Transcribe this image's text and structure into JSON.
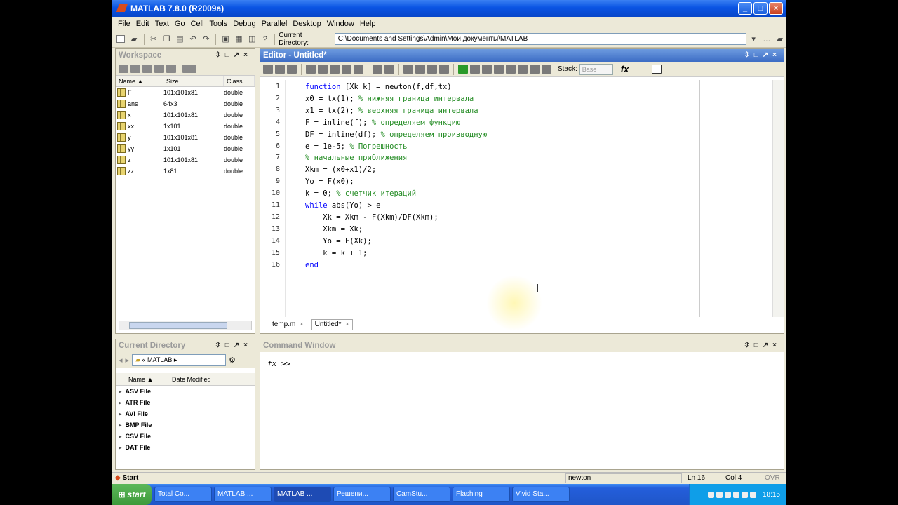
{
  "window": {
    "title": "MATLAB  7.8.0 (R2009a)"
  },
  "menu": [
    "File",
    "Edit",
    "Text",
    "Go",
    "Cell",
    "Tools",
    "Debug",
    "Parallel",
    "Desktop",
    "Window",
    "Help"
  ],
  "toolbar": {
    "current_folder": "C:\\Documents and Settings\\Admin\\Мои документы\\MATLAB"
  },
  "workspace": {
    "title": "Workspace",
    "columns": [
      "Name ▲",
      "Size",
      "Class"
    ],
    "rows": [
      {
        "name": "F",
        "size": "101x101x81",
        "class": "double"
      },
      {
        "name": "ans",
        "size": "64x3",
        "class": "double"
      },
      {
        "name": "x",
        "size": "101x101x81",
        "class": "double"
      },
      {
        "name": "xx",
        "size": "1x101",
        "class": "double"
      },
      {
        "name": "y",
        "size": "101x101x81",
        "class": "double"
      },
      {
        "name": "yy",
        "size": "1x101",
        "class": "double"
      },
      {
        "name": "z",
        "size": "101x101x81",
        "class": "double"
      },
      {
        "name": "zz",
        "size": "1x81",
        "class": "double"
      }
    ]
  },
  "editor": {
    "title": "Editor - Untitled*",
    "stack_label": "Stack:",
    "stack_value": "Base",
    "fx_label": "fx",
    "lines": [
      {
        "n": "1",
        "code": "function [Xk k] = newton(f,df,tx)",
        "comment": ""
      },
      {
        "n": "2",
        "code": "x0 = tx(1); ",
        "comment": "% нижняя граница интервала"
      },
      {
        "n": "3",
        "code": "x1 = tx(2); ",
        "comment": "% верхняя граница интервала"
      },
      {
        "n": "4",
        "code": "F = inline(f); ",
        "comment": "% определяем функцию"
      },
      {
        "n": "5",
        "code": "DF = inline(df); ",
        "comment": "% определяем производную"
      },
      {
        "n": "6",
        "code": "e = 1e-5; ",
        "comment": "% Погрешность"
      },
      {
        "n": "7",
        "code": "",
        "comment": "% начальные приближения"
      },
      {
        "n": "8",
        "code": "Xkm = (x0+x1)/2;",
        "comment": ""
      },
      {
        "n": "9",
        "code": "Yo = F(x0);",
        "comment": ""
      },
      {
        "n": "10",
        "code": "k = 0; ",
        "comment": "% счетчик итераций"
      },
      {
        "n": "11",
        "code": "while abs(Yo) > e",
        "comment": ""
      },
      {
        "n": "12",
        "code": "    Xk = Xkm - F(Xkm)/DF(Xkm);",
        "comment": ""
      },
      {
        "n": "13",
        "code": "    Xkm = Xk;",
        "comment": ""
      },
      {
        "n": "14",
        "code": "    Yo = F(Xk);",
        "comment": ""
      },
      {
        "n": "15",
        "code": "    k = k + 1;",
        "comment": ""
      },
      {
        "n": "16",
        "code": "end",
        "comment": ""
      }
    ],
    "tabs": [
      {
        "label": "temp.m",
        "close": "×"
      },
      {
        "label": "Untitled*",
        "close": "×"
      }
    ]
  },
  "current_directory": {
    "title": "Current Directory",
    "path": "« MATLAB ▸",
    "columns": [
      "Name ▲",
      "Date Modified"
    ],
    "items": [
      "ASV File",
      "ATR File",
      "AVI File",
      "BMP File",
      "CSV File",
      "DAT File"
    ]
  },
  "command_window": {
    "title": "Command Window",
    "fx": "fx",
    "prompt": ">>"
  },
  "status": {
    "start": "Start",
    "function": "newton",
    "ln_label": "Ln",
    "ln": "16",
    "col_label": "Col",
    "col": "4",
    "ovr": "OVR"
  },
  "taskbar": {
    "start": "start",
    "tasks": [
      "Total Co...",
      "MATLAB ...",
      "MATLAB ...",
      "Решени...",
      "CamStu...",
      "Flashing",
      "Vivid Sta..."
    ],
    "clock": "18:15"
  }
}
